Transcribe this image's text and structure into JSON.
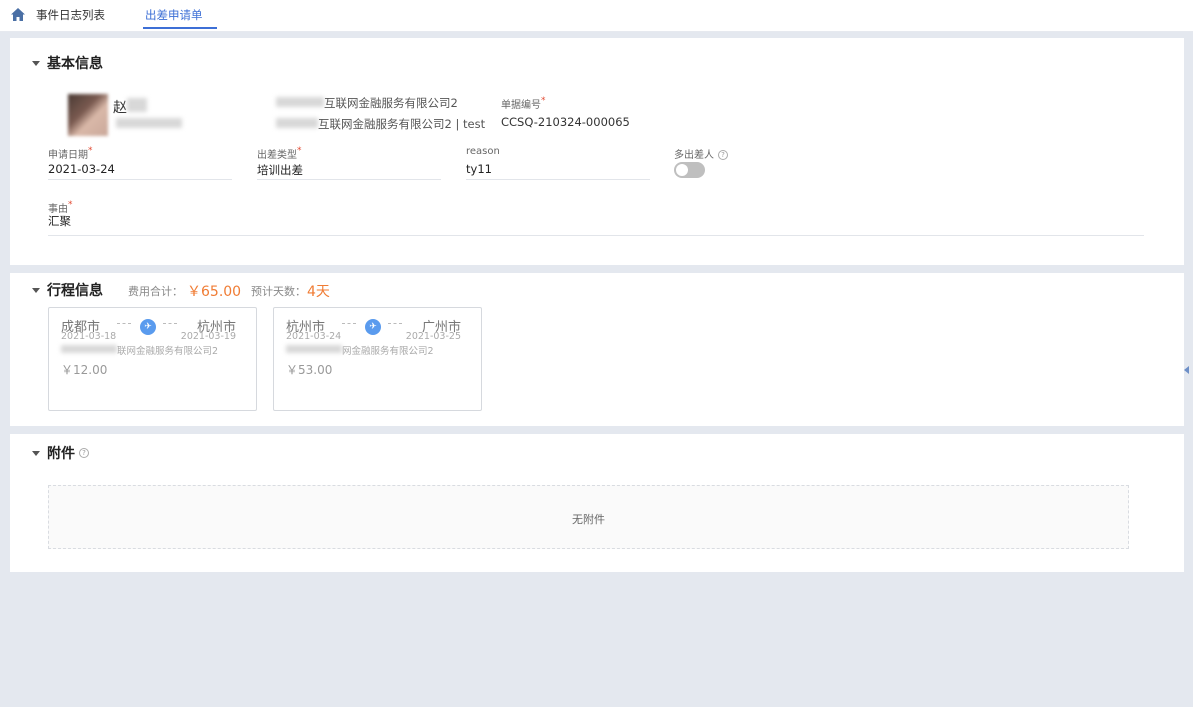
{
  "tabs": [
    {
      "label": "事件日志列表",
      "active": false
    },
    {
      "label": "出差申请单",
      "active": true
    }
  ],
  "basic": {
    "title": "基本信息",
    "user_name": "赵",
    "company_line1": "互联网金融服务有限公司2",
    "company_line2": "互联网金融服务有限公司2 | test",
    "doc_no_label": "单据编号",
    "doc_no": "CCSQ-210324-000065",
    "apply_date_label": "申请日期",
    "apply_date": "2021-03-24",
    "trip_type_label": "出差类型",
    "trip_type": "培训出差",
    "reason_label": "reason",
    "reason": "ty11",
    "multi_label": "多出差人",
    "multi_enabled": false,
    "cause_label": "事由",
    "cause": "汇聚"
  },
  "itinerary": {
    "title": "行程信息",
    "cost_label": "费用合计：",
    "cost_value": "￥65.00",
    "days_label": "预计天数：",
    "days_value": "4天",
    "trips": [
      {
        "from": "成都市",
        "from_date": "2021-03-18",
        "to": "杭州市",
        "to_date": "2021-03-19",
        "company": "联网金融服务有限公司2",
        "price": "￥12.00"
      },
      {
        "from": "杭州市",
        "from_date": "2021-03-24",
        "to": "广州市",
        "to_date": "2021-03-25",
        "company": "网金融服务有限公司2",
        "price": "￥53.00"
      }
    ]
  },
  "attachment": {
    "title": "附件",
    "empty_text": "无附件"
  },
  "colors": {
    "accent": "#3d6fd6",
    "highlight": "#f07c34",
    "required": "#e24b33",
    "background": "#e4e8ef"
  }
}
